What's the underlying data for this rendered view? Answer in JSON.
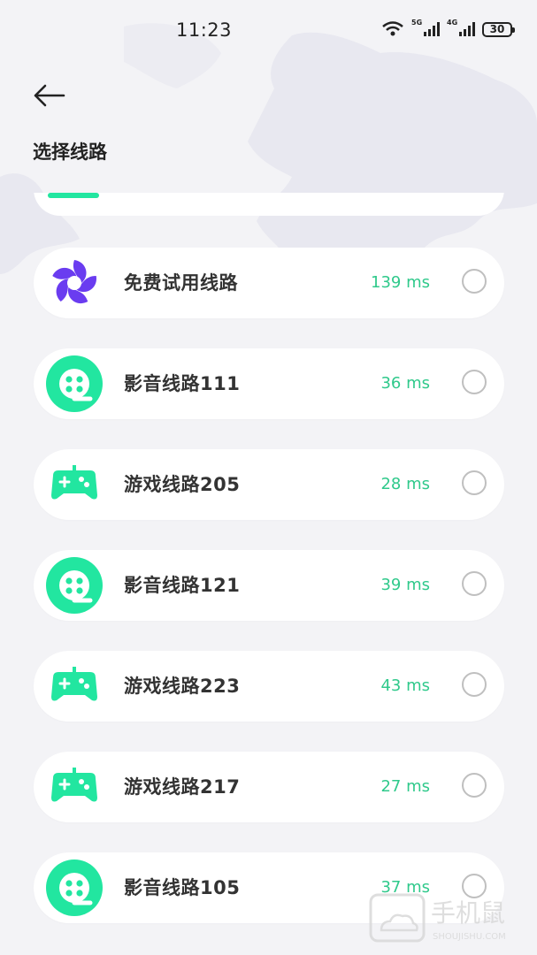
{
  "status_bar": {
    "time": "11:23",
    "net1": "5G",
    "net2": "4G",
    "battery": "30"
  },
  "header": {
    "title": "选择线路"
  },
  "lines": [
    {
      "name": "免费试用线路",
      "latency": "139 ms",
      "icon": "flower-logo-icon"
    },
    {
      "name": "影音线路111",
      "latency": "36 ms",
      "icon": "film-reel-icon"
    },
    {
      "name": "游戏线路205",
      "latency": "28 ms",
      "icon": "gamepad-icon"
    },
    {
      "name": "影音线路121",
      "latency": "39 ms",
      "icon": "film-reel-icon"
    },
    {
      "name": "游戏线路223",
      "latency": "43 ms",
      "icon": "gamepad-icon"
    },
    {
      "name": "游戏线路217",
      "latency": "27 ms",
      "icon": "gamepad-icon"
    },
    {
      "name": "影音线路105",
      "latency": "37 ms",
      "icon": "film-reel-icon"
    }
  ],
  "colors": {
    "accent": "#2fc98b",
    "icon_green": "#22e6a0",
    "logo_purple": "#6a3cf0"
  },
  "watermark": {
    "brand": "手机鼠",
    "url": "SHOUJISHU.COM"
  }
}
